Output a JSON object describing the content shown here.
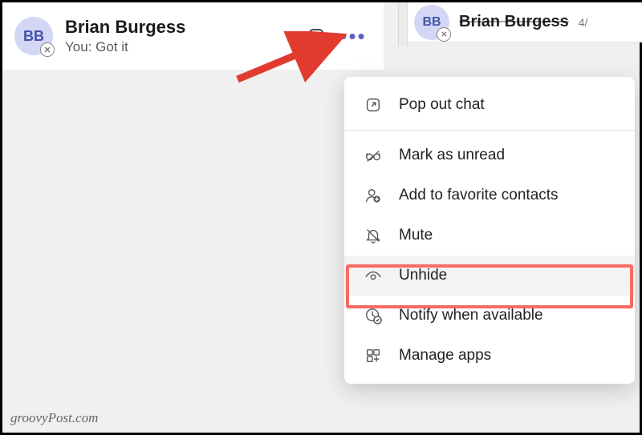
{
  "chat_item": {
    "avatar_initials": "BB",
    "name": "Brian Burgess",
    "preview": "You: Got it"
  },
  "right_header": {
    "avatar_initials": "BB",
    "name": "Brian Burgess",
    "date_fragment": "4/"
  },
  "menu": {
    "pop_out": "Pop out chat",
    "mark_unread": "Mark as unread",
    "add_favorite": "Add to favorite contacts",
    "mute": "Mute",
    "unhide": "Unhide",
    "notify": "Notify when available",
    "manage_apps": "Manage apps"
  },
  "watermark": "groovyPost.com",
  "colors": {
    "accent": "#5b5fc7",
    "highlight": "#f76b63"
  }
}
